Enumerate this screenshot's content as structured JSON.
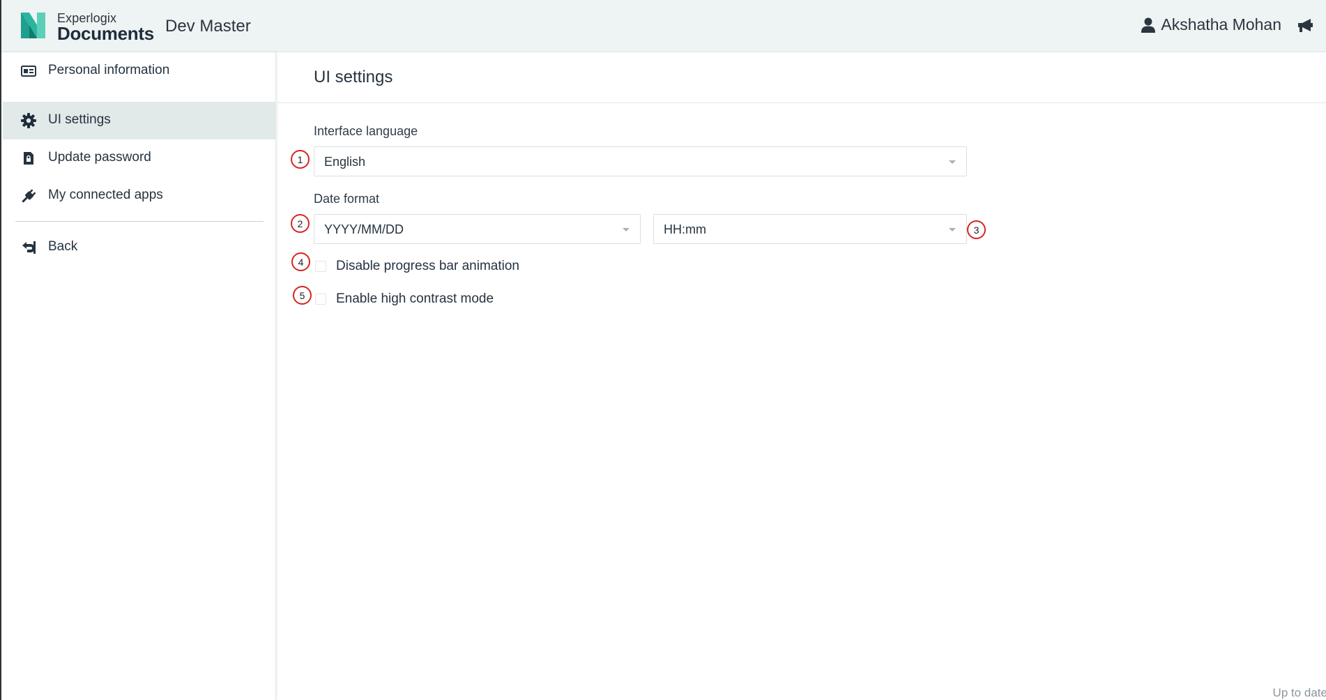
{
  "header": {
    "brand_top": "Experlogix",
    "brand_bottom": "Documents",
    "environment": "Dev Master",
    "user_name": "Akshatha Mohan"
  },
  "sidebar": {
    "items": [
      {
        "label": "Personal information",
        "icon": "id-card-icon"
      },
      {
        "label": "UI settings",
        "icon": "gear-icon",
        "active": true
      },
      {
        "label": "Update password",
        "icon": "lock-file-icon"
      },
      {
        "label": "My connected apps",
        "icon": "plug-icon"
      }
    ],
    "back_label": "Back"
  },
  "main": {
    "title": "UI settings",
    "interface_language": {
      "label": "Interface language",
      "value": "English"
    },
    "date_format": {
      "label": "Date format",
      "date_value": "YYYY/MM/DD",
      "time_value": "HH:mm"
    },
    "options": [
      {
        "label": "Disable progress bar animation",
        "checked": false
      },
      {
        "label": "Enable high contrast mode",
        "checked": false
      }
    ]
  },
  "markers": [
    "1",
    "2",
    "3",
    "4",
    "5"
  ],
  "status": "Up to date",
  "colors": {
    "header_bg": "#eef3f3",
    "active_nav_bg": "#e2e9e9",
    "marker_red": "#d6241f",
    "logo_teal": "#2bb5a0"
  }
}
